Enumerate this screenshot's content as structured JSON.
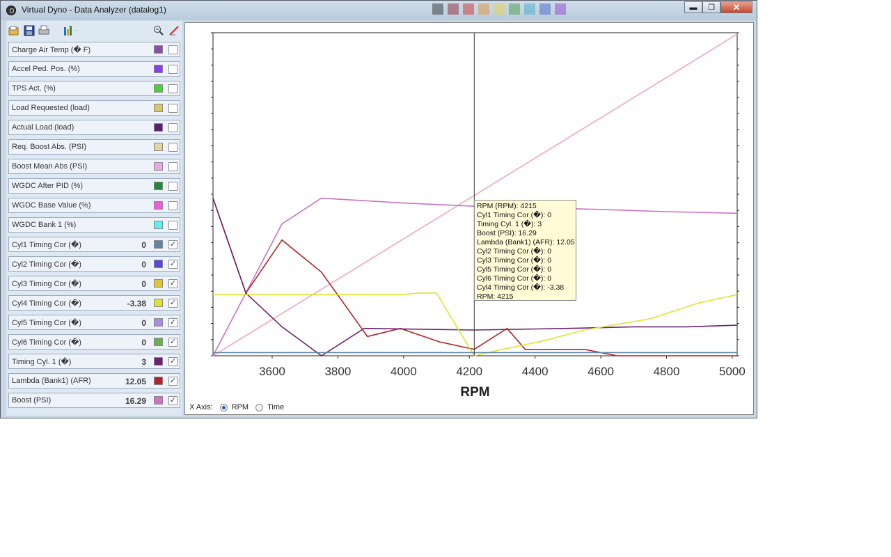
{
  "window": {
    "title": "Virtual Dyno - Data Analyzer (datalog1)",
    "min_symbol": "▬",
    "max_symbol": "❐",
    "close_symbol": "✕"
  },
  "toolbar": {
    "icons": [
      "open-icon",
      "save-icon",
      "print-icon",
      "chart-options-icon",
      "zoom-icon",
      "clear-icon"
    ]
  },
  "parameters": [
    {
      "label": "Charge Air Temp (� F)",
      "value": "",
      "color": "#8b4fa3",
      "checked": false
    },
    {
      "label": "Accel Ped. Pos. (%)",
      "value": "",
      "color": "#8c3cf0",
      "checked": false
    },
    {
      "label": "TPS Act. (%)",
      "value": "",
      "color": "#44d535",
      "checked": false
    },
    {
      "label": "Load Requested (load)",
      "value": "",
      "color": "#d9c66c",
      "checked": false
    },
    {
      "label": "Actual Load (load)",
      "value": "",
      "color": "#5a1f6e",
      "checked": false
    },
    {
      "label": "Req. Boost Abs. (PSI)",
      "value": "",
      "color": "#dcd8a0",
      "checked": false
    },
    {
      "label": "Boost Mean Abs (PSI)",
      "value": "",
      "color": "#eba7e8",
      "checked": false
    },
    {
      "label": "WGDC After PID (%)",
      "value": "",
      "color": "#208a3c",
      "checked": false
    },
    {
      "label": "WGDC Base Value (%)",
      "value": "",
      "color": "#ee5ed7",
      "checked": false
    },
    {
      "label": "WGDC Bank 1 (%)",
      "value": "",
      "color": "#5af2f5",
      "checked": false
    },
    {
      "label": "Cyl1 Timing Cor (�)",
      "value": "0",
      "color": "#5d86a5",
      "checked": true
    },
    {
      "label": "Cyl2 Timing Cor (�)",
      "value": "0",
      "color": "#5b47e0",
      "checked": true
    },
    {
      "label": "Cyl3 Timing Cor (�)",
      "value": "0",
      "color": "#e0c43a",
      "checked": true
    },
    {
      "label": "Cyl4 Timing Cor (�)",
      "value": "-3.38",
      "color": "#dde42f",
      "checked": true
    },
    {
      "label": "Cyl5 Timing Cor (�)",
      "value": "0",
      "color": "#a48ee3",
      "checked": true
    },
    {
      "label": "Cyl6 Timing Cor (�)",
      "value": "0",
      "color": "#6fae4c",
      "checked": true
    },
    {
      "label": "Timing Cyl. 1 (�)",
      "value": "3",
      "color": "#6b2270",
      "checked": true
    },
    {
      "label": "Lambda (Bank1) (AFR)",
      "value": "12.05",
      "color": "#b42225",
      "checked": true
    },
    {
      "label": "Boost (PSI)",
      "value": "16.29",
      "color": "#cc72c2",
      "checked": true
    }
  ],
  "chart_data": {
    "type": "line",
    "xlabel": "RPM",
    "x_ticks": [
      3600,
      3800,
      4000,
      4200,
      4400,
      4600,
      4800,
      5000
    ],
    "xlim": [
      3420,
      5015
    ],
    "cursor_x": 4215,
    "series": [
      {
        "name": "RPM (RPM)",
        "color": "#f0a8b8",
        "points": [
          [
            3420,
            0.0
          ],
          [
            5015,
            1.0
          ]
        ]
      },
      {
        "name": "Boost (PSI)",
        "color": "#cc72c2",
        "points": [
          [
            3420,
            0.0
          ],
          [
            3630,
            0.41
          ],
          [
            3750,
            0.49
          ],
          [
            4000,
            0.475
          ],
          [
            4215,
            0.465
          ],
          [
            4400,
            0.46
          ],
          [
            4600,
            0.455
          ],
          [
            4800,
            0.448
          ],
          [
            5015,
            0.443
          ]
        ]
      },
      {
        "name": "Lambda (Bank1) (AFR)",
        "color": "#b42225",
        "points": [
          [
            3420,
            0.49
          ],
          [
            3520,
            0.195
          ],
          [
            3630,
            0.36
          ],
          [
            3750,
            0.26
          ],
          [
            3890,
            0.06
          ],
          [
            3990,
            0.085
          ],
          [
            4110,
            0.043
          ],
          [
            4215,
            0.02
          ],
          [
            4315,
            0.085
          ],
          [
            4370,
            0.02
          ],
          [
            4550,
            0.02
          ],
          [
            4650,
            0.0
          ],
          [
            5015,
            0.0
          ]
        ]
      },
      {
        "name": "Timing Cyl. 1 (�)",
        "color": "#6b2270",
        "points": [
          [
            3420,
            0.49
          ],
          [
            3520,
            0.195
          ],
          [
            3630,
            0.09
          ],
          [
            3750,
            0.0
          ],
          [
            3880,
            0.085
          ],
          [
            4215,
            0.08
          ],
          [
            4500,
            0.085
          ],
          [
            4700,
            0.09
          ],
          [
            4860,
            0.09
          ],
          [
            5015,
            0.095
          ]
        ]
      },
      {
        "name": "Cyl4 Timing Cor (�)",
        "color": "#dde42f",
        "points": [
          [
            3420,
            0.19
          ],
          [
            3990,
            0.19
          ],
          [
            4050,
            0.195
          ],
          [
            4100,
            0.195
          ],
          [
            4215,
            0.0
          ],
          [
            4300,
            0.02
          ],
          [
            4420,
            0.045
          ],
          [
            4550,
            0.08
          ],
          [
            4750,
            0.115
          ],
          [
            4900,
            0.165
          ],
          [
            5015,
            0.19
          ]
        ]
      },
      {
        "name": "Cyl1 Timing Cor (�)",
        "color": "#5d86a5",
        "points": [
          [
            3420,
            0.01
          ],
          [
            5015,
            0.01
          ]
        ]
      }
    ]
  },
  "tooltip": [
    "RPM (RPM): 4215",
    "Cyl1 Timing Cor (�): 0",
    "Timing Cyl. 1 (�): 3",
    "Boost (PSI): 16.29",
    "Lambda (Bank1) (AFR): 12.05",
    "Cyl2 Timing Cor (�): 0",
    "Cyl3 Timing Cor (�): 0",
    "Cyl5 Timing Cor (�): 0",
    "Cyl6 Timing Cor (�): 0",
    "Cyl4 Timing Cor (�): -3.38",
    "RPM: 4215"
  ],
  "xaxis_mode": {
    "label": "X Axis:",
    "options": [
      {
        "label": "RPM",
        "selected": true
      },
      {
        "label": "Time",
        "selected": false
      }
    ]
  }
}
